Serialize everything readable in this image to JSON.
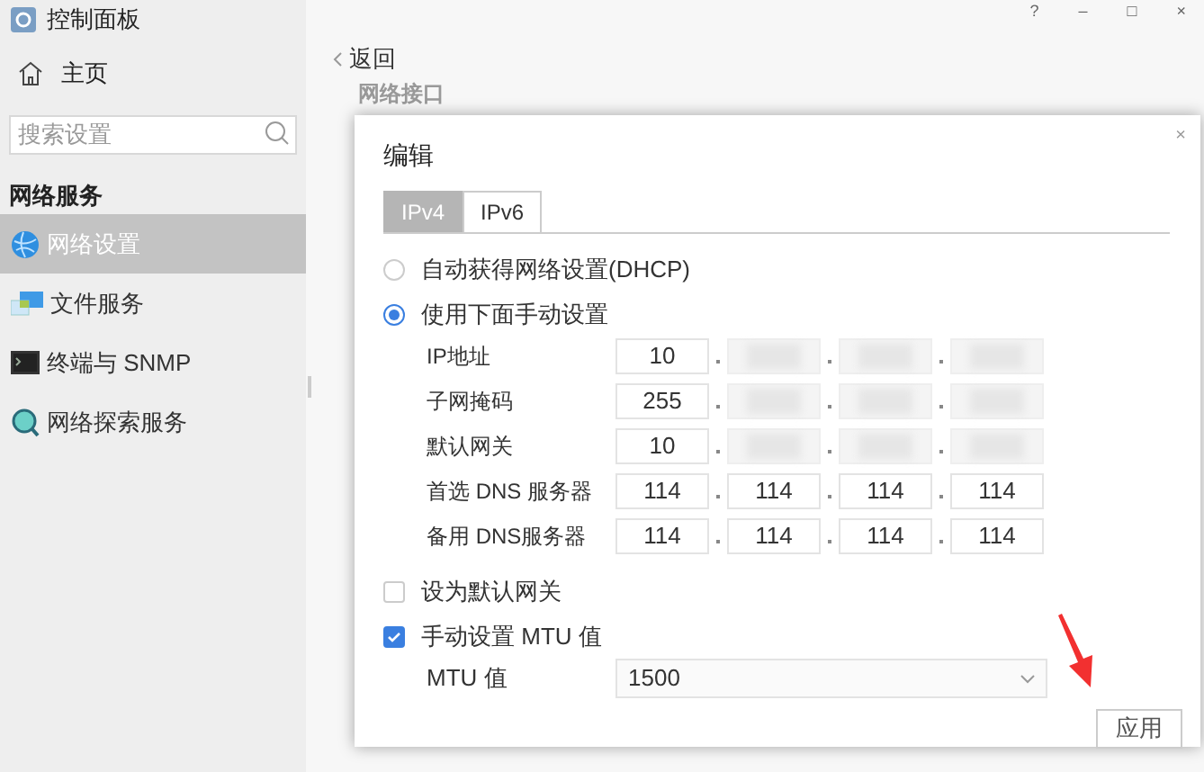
{
  "app_title": "控制面板",
  "window_controls": [
    "?",
    "–",
    "□",
    "×"
  ],
  "home": {
    "label": "主页"
  },
  "search": {
    "placeholder": "搜索设置"
  },
  "section": "网络服务",
  "sidebar": {
    "items": [
      {
        "label": "网络设置",
        "kind": "globe",
        "selected": true
      },
      {
        "label": "文件服务",
        "kind": "files",
        "selected": false
      },
      {
        "label": "终端与 SNMP",
        "kind": "terminal",
        "selected": false
      },
      {
        "label": "网络探索服务",
        "kind": "search",
        "selected": false
      }
    ]
  },
  "back": {
    "label": "返回"
  },
  "page_heading": "网络接口",
  "dialog": {
    "title": "编辑",
    "close": "×",
    "tabs": [
      {
        "label": "IPv4",
        "selected": true
      },
      {
        "label": "IPv6",
        "selected": false
      }
    ],
    "modes": [
      {
        "label": "自动获得网络设置(DHCP)",
        "selected": false
      },
      {
        "label": "使用下面手动设置",
        "selected": true
      }
    ],
    "rows": [
      {
        "label": "IP地址",
        "octets": [
          {
            "kind": "value",
            "value": "10"
          },
          {
            "kind": "blurred"
          },
          {
            "kind": "blurred"
          },
          {
            "kind": "blurred"
          }
        ]
      },
      {
        "label": "子网掩码",
        "octets": [
          {
            "kind": "value",
            "value": "255"
          },
          {
            "kind": "blurred"
          },
          {
            "kind": "blurred"
          },
          {
            "kind": "blurred"
          }
        ]
      },
      {
        "label": "默认网关",
        "octets": [
          {
            "kind": "value",
            "value": "10"
          },
          {
            "kind": "blurred"
          },
          {
            "kind": "blurred"
          },
          {
            "kind": "blurred"
          }
        ]
      },
      {
        "label": "首选 DNS 服务器",
        "octets": [
          {
            "kind": "value",
            "value": "114"
          },
          {
            "kind": "value",
            "value": "114"
          },
          {
            "kind": "value",
            "value": "114"
          },
          {
            "kind": "value",
            "value": "114"
          }
        ]
      },
      {
        "label": "备用 DNS服务器",
        "octets": [
          {
            "kind": "value",
            "value": "114"
          },
          {
            "kind": "value",
            "value": "114"
          },
          {
            "kind": "value",
            "value": "114"
          },
          {
            "kind": "value",
            "value": "114"
          }
        ]
      }
    ],
    "default_gateway": {
      "label": "设为默认网关",
      "checked": false
    },
    "manual_mtu": {
      "label": "手动设置 MTU 值",
      "checked": true
    },
    "mtu": {
      "label": "MTU 值",
      "value": "1500"
    },
    "apply": "应用"
  }
}
